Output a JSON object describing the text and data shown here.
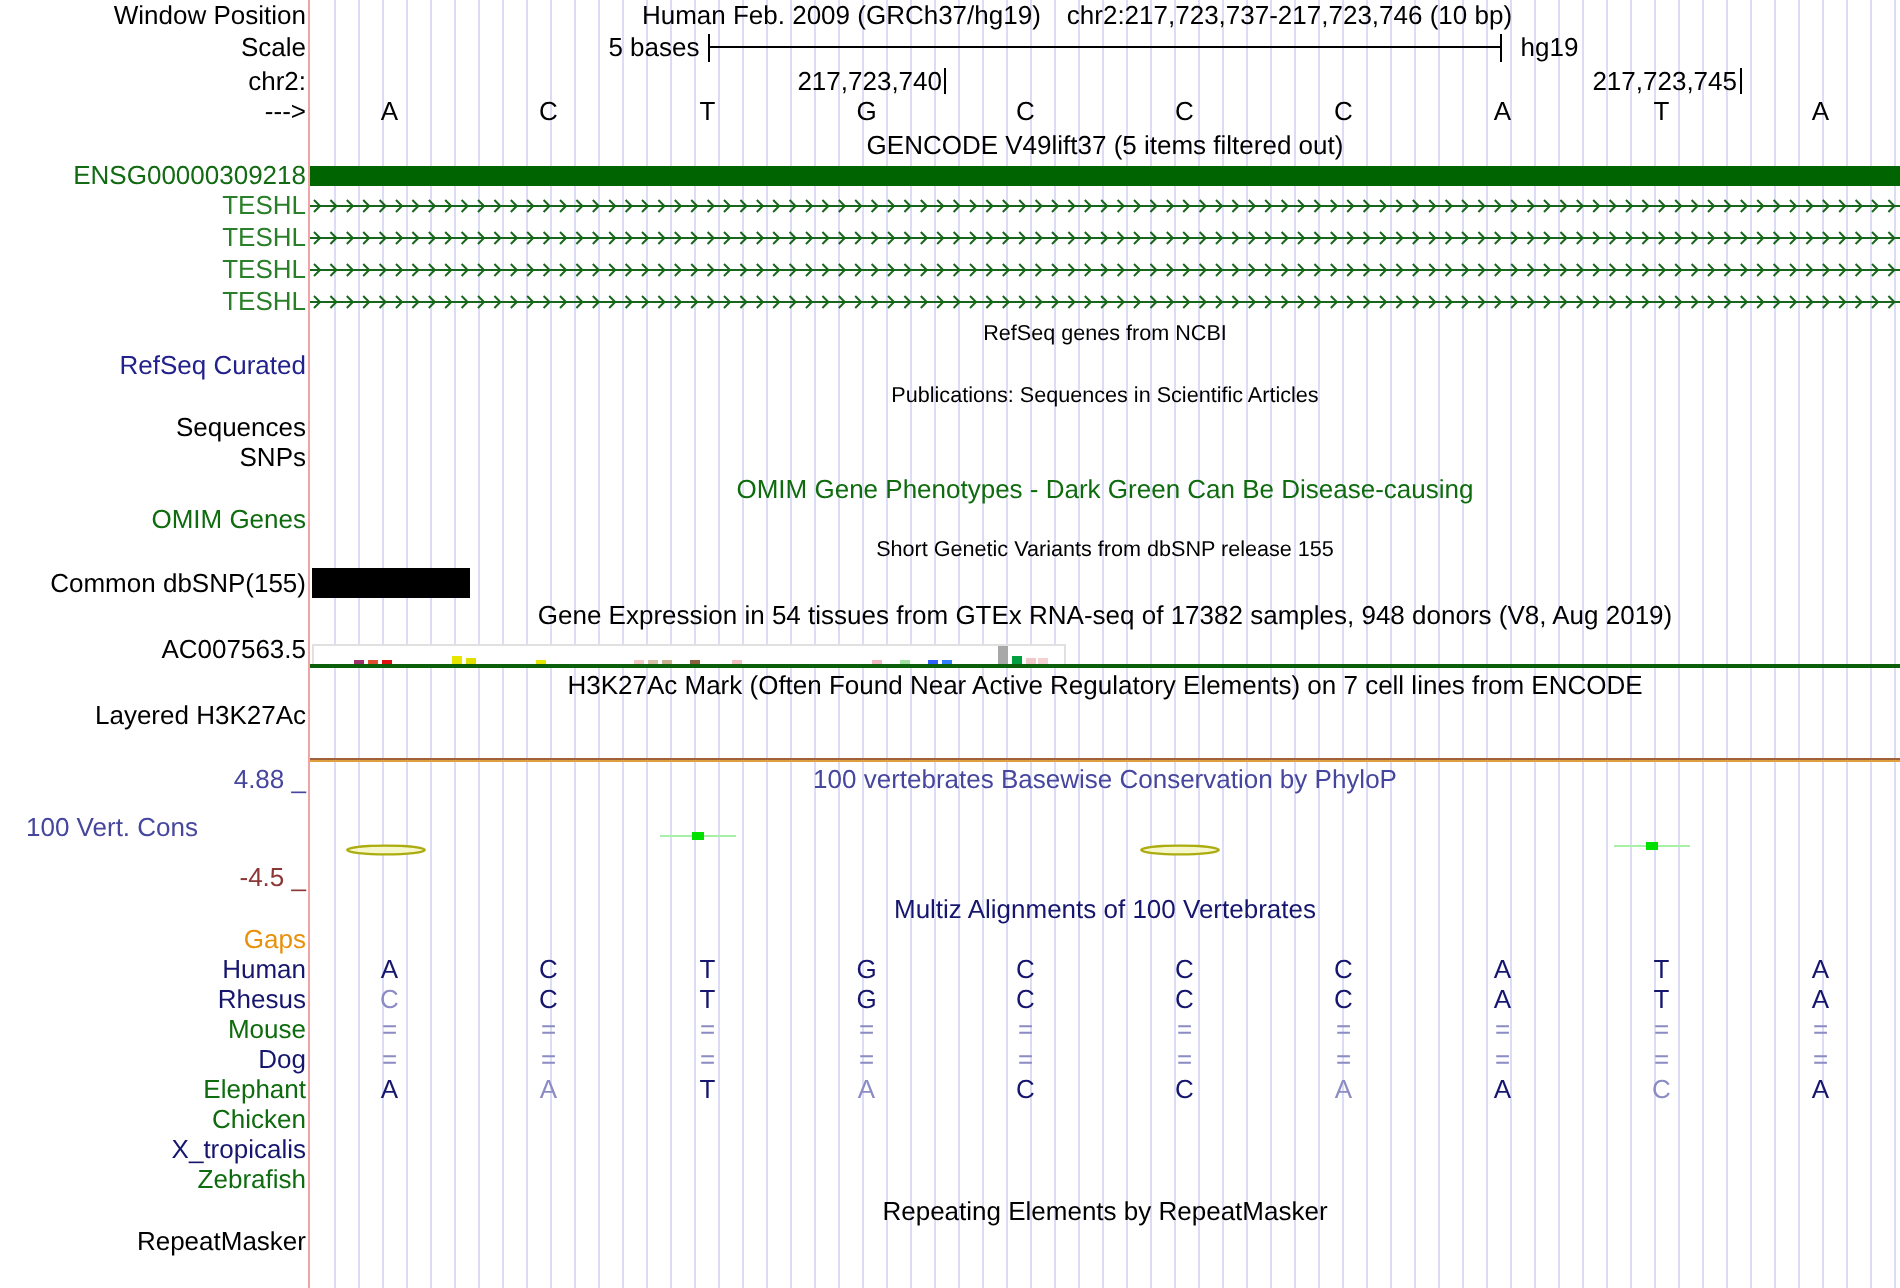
{
  "window_position": {
    "label": "Window Position",
    "assembly": "Human Feb. 2009 (GRCh37/hg19)",
    "position": "chr2:217,723,737-217,723,746 (10 bp)"
  },
  "scale": {
    "label": "Scale",
    "span": "5 bases",
    "assembly": "hg19"
  },
  "ruler": {
    "label": "chr2:",
    "ticks": [
      "217,723,740",
      "217,723,745"
    ]
  },
  "sequence": {
    "label": "--->",
    "bases": [
      "A",
      "C",
      "T",
      "G",
      "C",
      "C",
      "C",
      "A",
      "T",
      "A"
    ]
  },
  "tracks": [
    {
      "kind": "title",
      "text": "GENCODE V49lift37 (5 items filtered out)",
      "color": "#000000"
    },
    {
      "kind": "gene_bar",
      "label": "ENSG00000309218",
      "color": "#126a12"
    },
    {
      "kind": "transcript",
      "label": "TESHL",
      "color": "#2a7f2a"
    },
    {
      "kind": "transcript",
      "label": "TESHL",
      "color": "#2a7f2a"
    },
    {
      "kind": "transcript",
      "label": "TESHL",
      "color": "#2a7f2a"
    },
    {
      "kind": "transcript",
      "label": "TESHL",
      "color": "#2a7f2a"
    },
    {
      "kind": "caption",
      "text": "RefSeq genes from NCBI",
      "color": "#000000"
    },
    {
      "kind": "empty",
      "label": "RefSeq Curated",
      "color": "#22228c"
    },
    {
      "kind": "caption",
      "text": "Publications: Sequences in Scientific Articles",
      "color": "#000000"
    },
    {
      "kind": "empty",
      "label": "Sequences",
      "color": "#000000"
    },
    {
      "kind": "empty",
      "label": "SNPs",
      "color": "#000000"
    },
    {
      "kind": "title",
      "text": "OMIM Gene Phenotypes - Dark Green Can Be Disease-causing",
      "color": "#0e6b0e"
    },
    {
      "kind": "empty",
      "label": "OMIM Genes",
      "color": "#0e6b0e"
    },
    {
      "kind": "caption",
      "text": "Short Genetic Variants from dbSNP release 155",
      "color": "#000000"
    },
    {
      "kind": "snp_bar",
      "label": "Common dbSNP(155)",
      "color": "#000000"
    },
    {
      "kind": "title",
      "text": "Gene Expression in 54 tissues from GTEx RNA-seq of 17382 samples, 948 donors (V8, Aug 2019)",
      "color": "#000000"
    },
    {
      "kind": "expression",
      "label": "AC007563.5",
      "color": "#000000"
    },
    {
      "kind": "title",
      "text": "H3K27Ac Mark (Often Found Near Active Regulatory Elements) on 7 cell lines from ENCODE",
      "color": "#000000"
    },
    {
      "kind": "signal",
      "label": "Layered H3K27Ac",
      "color": "#000000"
    },
    {
      "kind": "conservation",
      "title": "100 vertebrates Basewise Conservation by PhyloP",
      "label": "100 Vert. Cons",
      "color": "#46469e",
      "axis": [
        {
          "text": "4.88 _",
          "color": "#46469e"
        },
        {
          "text": "-4.5 _",
          "color": "#8c3636"
        }
      ]
    },
    {
      "kind": "title",
      "text": "Multiz Alignments of 100 Vertebrates",
      "color": "#16166e"
    },
    {
      "kind": "species",
      "label": "Gaps",
      "color": "#e8900a"
    },
    {
      "kind": "species",
      "label": "Human",
      "color": "#16166e",
      "bases": [
        {
          "base": "A",
          "dimmed": false
        },
        {
          "base": "C",
          "dimmed": false
        },
        {
          "base": "T",
          "dimmed": false
        },
        {
          "base": "G",
          "dimmed": false
        },
        {
          "base": "C",
          "dimmed": false
        },
        {
          "base": "C",
          "dimmed": false
        },
        {
          "base": "C",
          "dimmed": false
        },
        {
          "base": "A",
          "dimmed": false
        },
        {
          "base": "T",
          "dimmed": false
        },
        {
          "base": "A",
          "dimmed": false
        }
      ]
    },
    {
      "kind": "species",
      "label": "Rhesus",
      "color": "#16166e",
      "bases": [
        {
          "base": "C",
          "dimmed": true
        },
        {
          "base": "C",
          "dimmed": false
        },
        {
          "base": "T",
          "dimmed": false
        },
        {
          "base": "G",
          "dimmed": false
        },
        {
          "base": "C",
          "dimmed": false
        },
        {
          "base": "C",
          "dimmed": false
        },
        {
          "base": "C",
          "dimmed": false
        },
        {
          "base": "A",
          "dimmed": false
        },
        {
          "base": "T",
          "dimmed": false
        },
        {
          "base": "A",
          "dimmed": false
        }
      ]
    },
    {
      "kind": "species",
      "label": "Mouse",
      "color": "#0e6b0e",
      "bases": [
        {
          "base": "=",
          "dimmed": true
        },
        {
          "base": "=",
          "dimmed": true
        },
        {
          "base": "=",
          "dimmed": true
        },
        {
          "base": "=",
          "dimmed": true
        },
        {
          "base": "=",
          "dimmed": true
        },
        {
          "base": "=",
          "dimmed": true
        },
        {
          "base": "=",
          "dimmed": true
        },
        {
          "base": "=",
          "dimmed": true
        },
        {
          "base": "=",
          "dimmed": true
        },
        {
          "base": "=",
          "dimmed": true
        }
      ]
    },
    {
      "kind": "species",
      "label": "Dog",
      "color": "#16166e",
      "bases": [
        {
          "base": "=",
          "dimmed": true
        },
        {
          "base": "=",
          "dimmed": true
        },
        {
          "base": "=",
          "dimmed": true
        },
        {
          "base": "=",
          "dimmed": true
        },
        {
          "base": "=",
          "dimmed": true
        },
        {
          "base": "=",
          "dimmed": true
        },
        {
          "base": "=",
          "dimmed": true
        },
        {
          "base": "=",
          "dimmed": true
        },
        {
          "base": "=",
          "dimmed": true
        },
        {
          "base": "=",
          "dimmed": true
        }
      ]
    },
    {
      "kind": "species",
      "label": "Elephant",
      "color": "#0e6b0e",
      "bases": [
        {
          "base": "A",
          "dimmed": false
        },
        {
          "base": "A",
          "dimmed": true
        },
        {
          "base": "T",
          "dimmed": false
        },
        {
          "base": "A",
          "dimmed": true
        },
        {
          "base": "C",
          "dimmed": false
        },
        {
          "base": "C",
          "dimmed": false
        },
        {
          "base": "A",
          "dimmed": true
        },
        {
          "base": "A",
          "dimmed": false
        },
        {
          "base": "C",
          "dimmed": true
        },
        {
          "base": "A",
          "dimmed": false
        }
      ]
    },
    {
      "kind": "species",
      "label": "Chicken",
      "color": "#0e6b0e"
    },
    {
      "kind": "species",
      "label": "X_tropicalis",
      "color": "#16166e"
    },
    {
      "kind": "species",
      "label": "Zebrafish",
      "color": "#0e6b0e"
    },
    {
      "kind": "title",
      "text": "Repeating Elements by RepeatMasker",
      "color": "#000000"
    },
    {
      "kind": "empty",
      "label": "RepeatMasker",
      "color": "#000000"
    }
  ]
}
